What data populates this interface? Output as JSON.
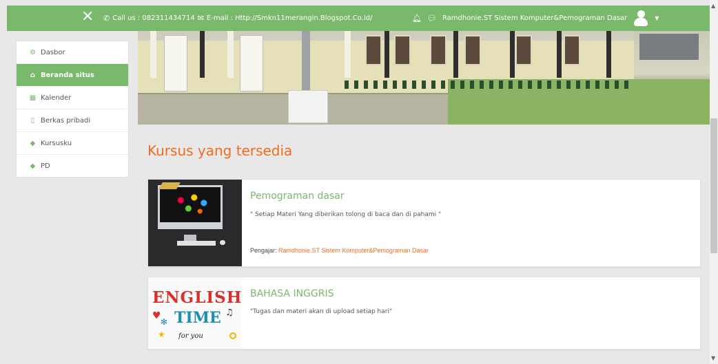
{
  "navbar": {
    "contact_text": "Call us : 082311434714",
    "email_text": "E-mail : Http://Smkn11merangin.Blogspot.Co.Id/",
    "user_name": "Ramdhonie.ST Sistem Komputer&Pemograman Dasar",
    "icons": {
      "close": "close-icon",
      "phone": "phone-icon",
      "mail": "mail-icon",
      "bell": "bell-icon",
      "chat": "chat-icon",
      "avatar": "user-avatar-icon",
      "caret": "caret-down-icon"
    },
    "color": "#7ab86c"
  },
  "sidebar": {
    "items": [
      {
        "label": "Dasbor",
        "icon": "dashboard-icon",
        "active": false
      },
      {
        "label": "Beranda situs",
        "icon": "home-icon",
        "active": true
      },
      {
        "label": "Kalender",
        "icon": "calendar-icon",
        "active": false
      },
      {
        "label": "Berkas pribadi",
        "icon": "file-icon",
        "active": false
      },
      {
        "label": "Kursusku",
        "icon": "graduation-cap-icon",
        "active": false
      },
      {
        "label": "PD",
        "icon": "graduation-cap-icon",
        "active": false
      }
    ]
  },
  "main": {
    "heading": "Kursus yang tersedia",
    "heading_color": "#f06c1e",
    "courses": [
      {
        "title": "Pemograman dasar",
        "summary": "\" Setiap Materi Yang diberikan tolong di baca dan di pahami \"",
        "teacher_label": "Pengajar: ",
        "teacher_name": "Ramdhonie.ST Sistem Komputer&Pemograman Dasar",
        "image": "computer-illustration"
      },
      {
        "title": "BAHASA INGGRIS",
        "summary": "\"Tugas dan materi akan di upload setiap hari\"",
        "image": "english-time-illustration",
        "image_text": {
          "line1": "ENGLISH",
          "line2": "TIME",
          "line3": "for you"
        }
      }
    ]
  }
}
